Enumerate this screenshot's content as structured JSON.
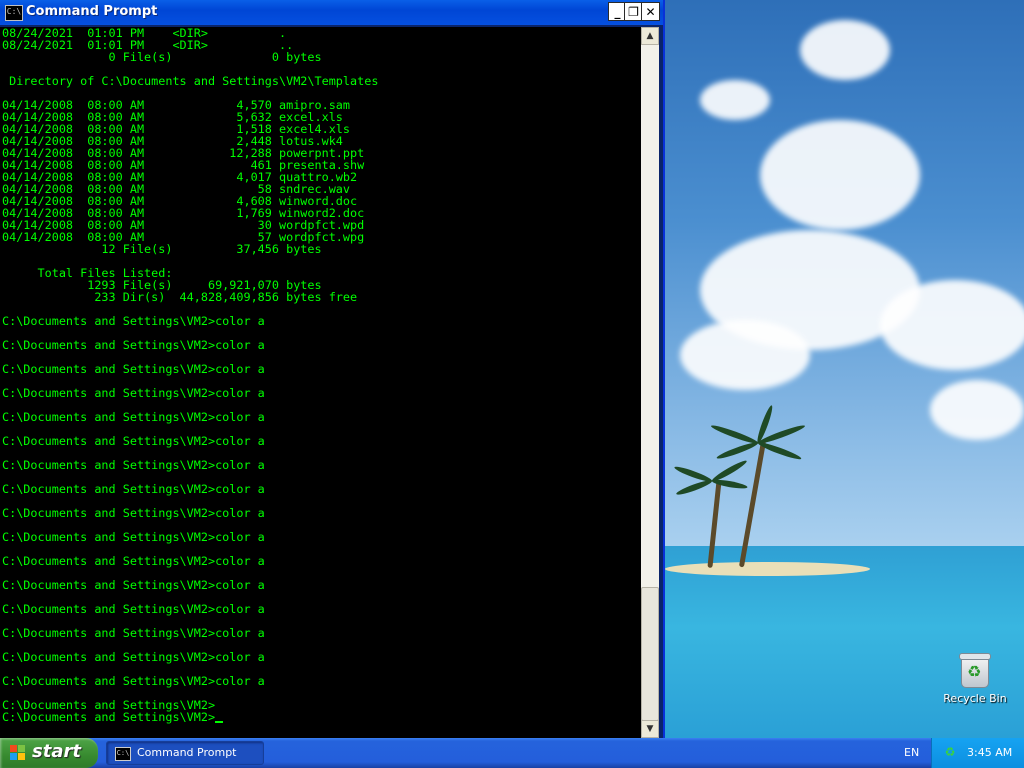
{
  "window": {
    "title": "Command Prompt",
    "icon_text": "C:\\",
    "buttons": {
      "minimize": "_",
      "maximize": "❐",
      "close": "✕"
    }
  },
  "console": {
    "text_color": "#00ff00",
    "background": "#000000",
    "lines": [
      "08/24/2021  01:01 PM    <DIR>          .",
      "08/24/2021  01:01 PM    <DIR>          ..",
      "               0 File(s)              0 bytes",
      "",
      " Directory of C:\\Documents and Settings\\VM2\\Templates",
      "",
      "04/14/2008  08:00 AM             4,570 amipro.sam",
      "04/14/2008  08:00 AM             5,632 excel.xls",
      "04/14/2008  08:00 AM             1,518 excel4.xls",
      "04/14/2008  08:00 AM             2,448 lotus.wk4",
      "04/14/2008  08:00 AM            12,288 powerpnt.ppt",
      "04/14/2008  08:00 AM               461 presenta.shw",
      "04/14/2008  08:00 AM             4,017 quattro.wb2",
      "04/14/2008  08:00 AM                58 sndrec.wav",
      "04/14/2008  08:00 AM             4,608 winword.doc",
      "04/14/2008  08:00 AM             1,769 winword2.doc",
      "04/14/2008  08:00 AM                30 wordpfct.wpd",
      "04/14/2008  08:00 AM                57 wordpfct.wpg",
      "              12 File(s)         37,456 bytes",
      "",
      "     Total Files Listed:",
      "            1293 File(s)     69,921,070 bytes",
      "             233 Dir(s)  44,828,409,856 bytes free",
      "",
      "C:\\Documents and Settings\\VM2>color a",
      "",
      "C:\\Documents and Settings\\VM2>color a",
      "",
      "C:\\Documents and Settings\\VM2>color a",
      "",
      "C:\\Documents and Settings\\VM2>color a",
      "",
      "C:\\Documents and Settings\\VM2>color a",
      "",
      "C:\\Documents and Settings\\VM2>color a",
      "",
      "C:\\Documents and Settings\\VM2>color a",
      "",
      "C:\\Documents and Settings\\VM2>color a",
      "",
      "C:\\Documents and Settings\\VM2>color a",
      "",
      "C:\\Documents and Settings\\VM2>color a",
      "",
      "C:\\Documents and Settings\\VM2>color a",
      "",
      "C:\\Documents and Settings\\VM2>color a",
      "",
      "C:\\Documents and Settings\\VM2>color a",
      "",
      "C:\\Documents and Settings\\VM2>color a",
      "",
      "C:\\Documents and Settings\\VM2>color a",
      "",
      "C:\\Documents and Settings\\VM2>color a",
      "",
      "C:\\Documents and Settings\\VM2>",
      "C:\\Documents and Settings\\VM2>"
    ]
  },
  "scrollbar": {
    "up": "▲",
    "down": "▼"
  },
  "desktop": {
    "icons": [
      {
        "label": "Recycle Bin",
        "icon": "recycle-bin-icon"
      }
    ]
  },
  "taskbar": {
    "start_label": "start",
    "tasks": [
      {
        "label": "Command Prompt",
        "icon_text": "C:\\"
      }
    ],
    "language": "EN",
    "tray_icon": "♻",
    "clock": "3:45 AM"
  }
}
